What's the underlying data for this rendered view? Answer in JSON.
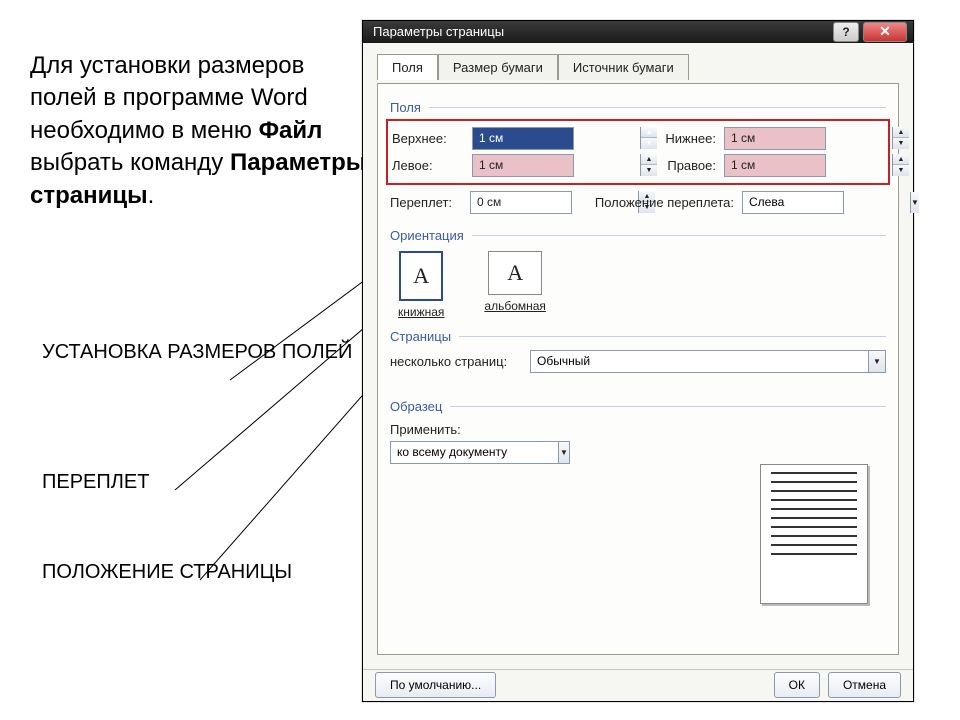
{
  "slide": {
    "description_pre": "Для установки размеров полей в программе Word необходимо в меню ",
    "description_bold1": "Файл",
    "description_mid": " выбрать команду ",
    "description_bold2": "Параметры страницы",
    "description_end": ".",
    "label_margins": "УСТАНОВКА РАЗМЕРОВ ПОЛЕЙ",
    "label_gutter": "ПЕРЕПЛЕТ",
    "label_orientation": "ПОЛОЖЕНИЕ СТРАНИЦЫ"
  },
  "dialog": {
    "title": "Параметры страницы",
    "help_icon": "?",
    "close_icon": "✕",
    "tabs": {
      "margins": "Поля",
      "paper": "Размер бумаги",
      "source": "Источник бумаги"
    },
    "sections": {
      "margins": "Поля",
      "orientation": "Ориентация",
      "pages": "Страницы",
      "preview": "Образец"
    },
    "fields": {
      "top_label": "Верхнее:",
      "top_value": "1 см",
      "bottom_label": "Нижнее:",
      "bottom_value": "1 см",
      "left_label": "Левое:",
      "left_value": "1 см",
      "right_label": "Правое:",
      "right_value": "1 см",
      "gutter_label": "Переплет:",
      "gutter_value": "0 см",
      "gutter_pos_label": "Положение переплета:",
      "gutter_pos_value": "Слева",
      "pages_label": "несколько страниц:",
      "pages_value": "Обычный",
      "apply_label": "Применить:",
      "apply_value": "ко всему документу"
    },
    "orientation": {
      "portrait": "книжная",
      "landscape": "альбомная",
      "glyph": "A"
    },
    "buttons": {
      "default": "По умолчанию...",
      "ok": "ОК",
      "cancel": "Отмена"
    },
    "spinner": {
      "up": "▲",
      "down": "▼"
    },
    "dropdown_icon": "▼"
  }
}
